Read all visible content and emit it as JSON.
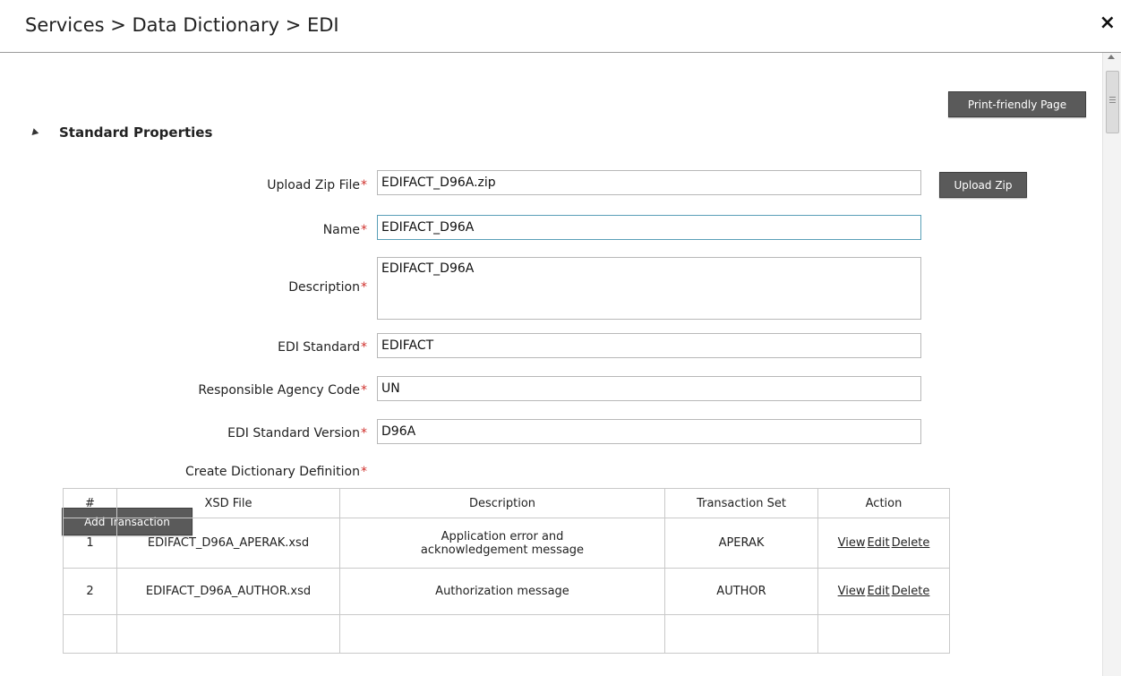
{
  "header": {
    "title": "Services > Data Dictionary > EDI",
    "close_icon": "×"
  },
  "toolbar": {
    "print_label": "Print-friendly Page"
  },
  "section": {
    "label": "Standard Properties"
  },
  "form": {
    "upload_zip": {
      "label": "Upload Zip File",
      "value": "EDIFACT_D96A.zip",
      "button": "Upload Zip"
    },
    "name": {
      "label": "Name",
      "value": "EDIFACT_D96A"
    },
    "description": {
      "label": "Description",
      "value": "EDIFACT_D96A"
    },
    "edi_standard": {
      "label": "EDI Standard",
      "value": "EDIFACT"
    },
    "agency_code": {
      "label": "Responsible Agency Code",
      "value": "UN"
    },
    "standard_version": {
      "label": "EDI Standard Version",
      "value": "D96A"
    },
    "create_definition": {
      "label": "Create Dictionary Definition"
    },
    "required_mark": "*"
  },
  "add_transaction_label": "Add Transaction",
  "table": {
    "headers": [
      "#",
      "XSD File",
      "Description",
      "Transaction Set",
      "Action"
    ],
    "rows": [
      {
        "num": "1",
        "xsd": "EDIFACT_D96A_APERAK.xsd",
        "desc_line1": "Application error and",
        "desc_line2": "acknowledgement message",
        "set": "APERAK"
      },
      {
        "num": "2",
        "xsd": "EDIFACT_D96A_AUTHOR.xsd",
        "desc_line1": "Authorization message",
        "desc_line2": "",
        "set": "AUTHOR"
      }
    ],
    "actions": {
      "view": "View",
      "edit": "Edit",
      "delete": "Delete"
    }
  }
}
